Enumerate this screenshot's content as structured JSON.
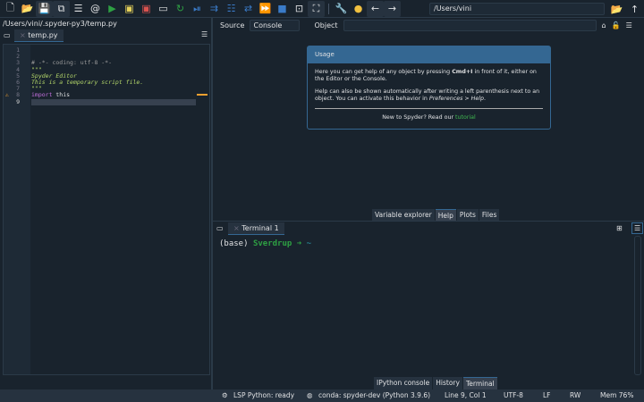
{
  "toolbar": {
    "icons": [
      "new-file-icon",
      "open-folder-icon",
      "save-icon",
      "save-all-icon",
      "outline-icon",
      "at-icon",
      "run-icon",
      "run-cell-icon",
      "run-cell-advance-icon",
      "run-selection-icon",
      "rerun-icon",
      "debug-step-icon",
      "debug-step-into-icon",
      "debug-step-return-icon",
      "debug-continue-icon",
      "stop-icon",
      "maximize-pane-icon",
      "fullscreen-icon",
      "wrench-icon",
      "python-icon",
      "back-icon",
      "forward-icon"
    ],
    "path": "/Users/vini"
  },
  "editor": {
    "path": "/Users/vini/.spyder-py3/temp.py",
    "tab": "temp.py",
    "lines": [
      "1",
      "2",
      "3",
      "4",
      "5",
      "6",
      "7",
      "8",
      "9"
    ],
    "code": [
      "# -*- coding: utf-8 -*-",
      "\"\"\"",
      "Spyder Editor",
      "",
      "This is a temporary script file.",
      "\"\"\"",
      "",
      "import",
      " this"
    ]
  },
  "help": {
    "source_label": "Source",
    "source_value": "Console",
    "object_label": "Object",
    "usage_title": "Usage",
    "p1a": "Here you can get help of any object by pressing ",
    "p1b": "Cmd+I",
    "p1c": " in front of it, either on the Editor or the Console.",
    "p2a": "Help can also be shown automatically after writing a left parenthesis next to an object. You can activate this behavior in ",
    "p2b": "Preferences > Help",
    "p2c": ".",
    "footer": "New to Spyder? Read our ",
    "link": "tutorial",
    "link_color": "#3fb950"
  },
  "top_tabs": [
    "Variable explorer",
    "Help",
    "Plots",
    "Files"
  ],
  "terminal": {
    "tab": "Terminal 1",
    "prompt_env": "(base)",
    "prompt_host": "Sverdrup",
    "prompt_arrow": "➜",
    "prompt_dir": "~"
  },
  "bottom_tabs": [
    "IPython console",
    "History",
    "Terminal"
  ],
  "status": {
    "lsp": "LSP Python: ready",
    "conda": "conda: spyder-dev (Python 3.9.6)",
    "position": "Line 9, Col 1",
    "encoding": "UTF-8",
    "eol": "LF",
    "perm": "RW",
    "mem": "Mem 76%"
  }
}
